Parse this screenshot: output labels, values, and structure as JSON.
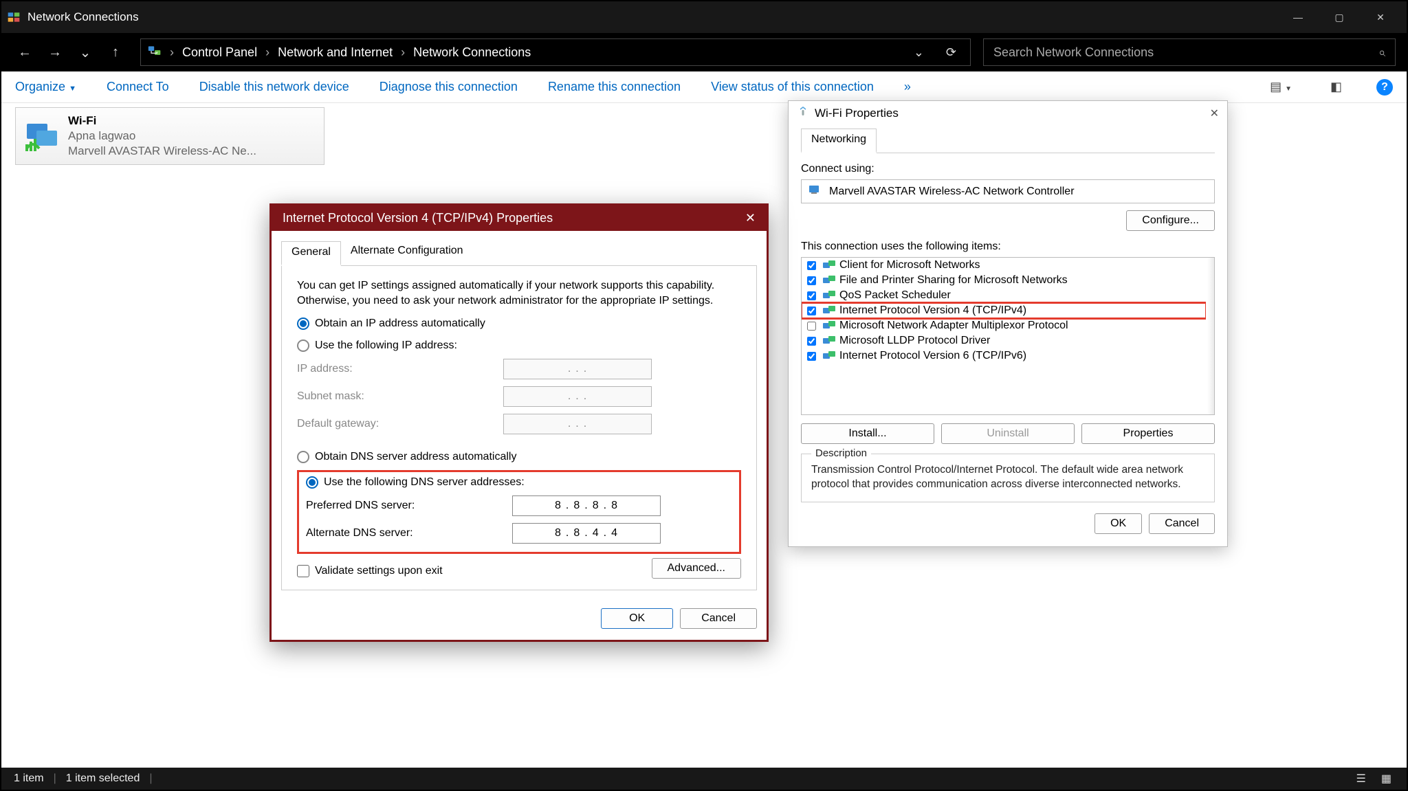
{
  "window": {
    "title": "Network Connections"
  },
  "breadcrumb": {
    "root": "Control Panel",
    "mid": "Network and Internet",
    "leaf": "Network Connections"
  },
  "search": {
    "placeholder": "Search Network Connections"
  },
  "toolbar": {
    "organize": "Organize",
    "connect": "Connect To",
    "disable": "Disable this network device",
    "diagnose": "Diagnose this connection",
    "rename": "Rename this connection",
    "status": "View status of this connection",
    "more": "»"
  },
  "tile": {
    "name": "Wi-Fi",
    "sub": "Apna lagwao",
    "device": "Marvell AVASTAR Wireless-AC Ne..."
  },
  "wifiprops": {
    "title": "Wi-Fi Properties",
    "tab": "Networking",
    "connect_label": "Connect using:",
    "adapter": "Marvell AVASTAR Wireless-AC Network Controller",
    "configure": "Configure...",
    "uses_label": "This connection uses the following items:",
    "items": [
      {
        "checked": true,
        "label": "Client for Microsoft Networks"
      },
      {
        "checked": true,
        "label": "File and Printer Sharing for Microsoft Networks"
      },
      {
        "checked": true,
        "label": "QoS Packet Scheduler"
      },
      {
        "checked": true,
        "label": "Internet Protocol Version 4 (TCP/IPv4)",
        "highlight": true
      },
      {
        "checked": false,
        "label": "Microsoft Network Adapter Multiplexor Protocol"
      },
      {
        "checked": true,
        "label": "Microsoft LLDP Protocol Driver"
      },
      {
        "checked": true,
        "label": "Internet Protocol Version 6 (TCP/IPv6)"
      }
    ],
    "install": "Install...",
    "uninstall": "Uninstall",
    "properties": "Properties",
    "desc_cap": "Description",
    "description": "Transmission Control Protocol/Internet Protocol. The default wide area network protocol that provides communication across diverse interconnected networks.",
    "ok": "OK",
    "cancel": "Cancel"
  },
  "ipv4": {
    "title": "Internet Protocol Version 4 (TCP/IPv4) Properties",
    "tab_general": "General",
    "tab_alt": "Alternate Configuration",
    "intro": "You can get IP settings assigned automatically if your network supports this capability. Otherwise, you need to ask your network administrator for the appropriate IP settings.",
    "radio_auto_ip": "Obtain an IP address automatically",
    "radio_static_ip": "Use the following IP address:",
    "lbl_ip": "IP address:",
    "lbl_mask": "Subnet mask:",
    "lbl_gw": "Default gateway:",
    "radio_auto_dns": "Obtain DNS server address automatically",
    "radio_static_dns": "Use the following DNS server addresses:",
    "lbl_pref": "Preferred DNS server:",
    "lbl_alt": "Alternate DNS server:",
    "pref_dns": [
      "8",
      "8",
      "8",
      "8"
    ],
    "alt_dns": [
      "8",
      "8",
      "4",
      "4"
    ],
    "validate": "Validate settings upon exit",
    "advanced": "Advanced...",
    "ok": "OK",
    "cancel": "Cancel"
  },
  "status": {
    "items": "1 item",
    "selected": "1 item selected"
  }
}
